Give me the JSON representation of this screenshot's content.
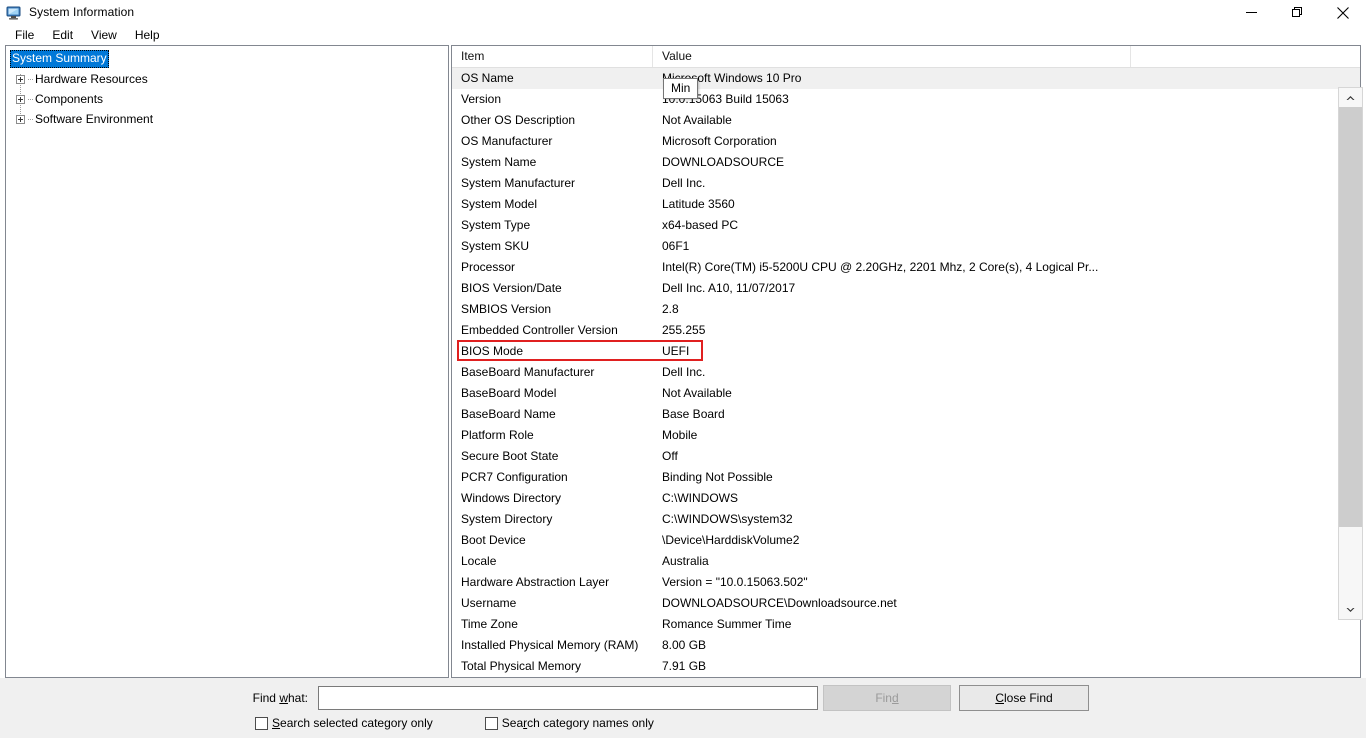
{
  "window": {
    "title": "System Information",
    "icon": "computer-icon",
    "controls": {
      "minimize": "minimize-icon",
      "restore": "restore-icon",
      "close": "close-icon"
    }
  },
  "menubar": {
    "items": [
      "File",
      "Edit",
      "View",
      "Help"
    ]
  },
  "tree": {
    "selected": "System Summary",
    "items": [
      {
        "label": "System Summary",
        "expandable": false,
        "selected": true
      },
      {
        "label": "Hardware Resources",
        "expandable": true,
        "selected": false
      },
      {
        "label": "Components",
        "expandable": true,
        "selected": false
      },
      {
        "label": "Software Environment",
        "expandable": true,
        "selected": false
      }
    ]
  },
  "tooltip": {
    "text": "Min"
  },
  "list": {
    "columns": [
      "Item",
      "Value"
    ],
    "rows": [
      {
        "item": "OS Name",
        "value": "Microsoft Windows 10 Pro"
      },
      {
        "item": "Version",
        "value": "10.0.15063 Build 15063"
      },
      {
        "item": "Other OS Description",
        "value": "Not Available"
      },
      {
        "item": "OS Manufacturer",
        "value": "Microsoft Corporation"
      },
      {
        "item": "System Name",
        "value": "DOWNLOADSOURCE"
      },
      {
        "item": "System Manufacturer",
        "value": "Dell Inc."
      },
      {
        "item": "System Model",
        "value": "Latitude 3560"
      },
      {
        "item": "System Type",
        "value": "x64-based PC"
      },
      {
        "item": "System SKU",
        "value": "06F1"
      },
      {
        "item": "Processor",
        "value": "Intel(R) Core(TM) i5-5200U CPU @ 2.20GHz, 2201 Mhz, 2 Core(s), 4 Logical Pr..."
      },
      {
        "item": "BIOS Version/Date",
        "value": "Dell Inc. A10, 11/07/2017"
      },
      {
        "item": "SMBIOS Version",
        "value": "2.8"
      },
      {
        "item": "Embedded Controller Version",
        "value": "255.255"
      },
      {
        "item": "BIOS Mode",
        "value": "UEFI",
        "highlighted": true
      },
      {
        "item": "BaseBoard Manufacturer",
        "value": "Dell Inc."
      },
      {
        "item": "BaseBoard Model",
        "value": "Not Available"
      },
      {
        "item": "BaseBoard Name",
        "value": "Base Board"
      },
      {
        "item": "Platform Role",
        "value": "Mobile"
      },
      {
        "item": "Secure Boot State",
        "value": "Off"
      },
      {
        "item": "PCR7 Configuration",
        "value": "Binding Not Possible"
      },
      {
        "item": "Windows Directory",
        "value": "C:\\WINDOWS"
      },
      {
        "item": "System Directory",
        "value": "C:\\WINDOWS\\system32"
      },
      {
        "item": "Boot Device",
        "value": "\\Device\\HarddiskVolume2"
      },
      {
        "item": "Locale",
        "value": "Australia"
      },
      {
        "item": "Hardware Abstraction Layer",
        "value": "Version = \"10.0.15063.502\""
      },
      {
        "item": "Username",
        "value": "DOWNLOADSOURCE\\Downloadsource.net"
      },
      {
        "item": "Time Zone",
        "value": "Romance Summer Time"
      },
      {
        "item": "Installed Physical Memory (RAM)",
        "value": "8.00 GB"
      },
      {
        "item": "Total Physical Memory",
        "value": "7.91 GB"
      }
    ]
  },
  "findbar": {
    "label_pre": "Find ",
    "label_accel": "w",
    "label_post": "hat:",
    "input_value": "",
    "input_placeholder": "",
    "find_button": {
      "pre": "Fin",
      "accel": "d",
      "post": "",
      "disabled": true
    },
    "close_button": {
      "pre": "",
      "accel": "C",
      "post": "lose Find",
      "disabled": false
    },
    "checkbox1": {
      "pre": "",
      "accel": "S",
      "post": "earch selected category only",
      "checked": false
    },
    "checkbox2": {
      "pre": "Sea",
      "accel": "r",
      "post": "ch category names only",
      "checked": false
    }
  },
  "scrollbar": {
    "up_arrow": "chevron-up-icon",
    "down_arrow": "chevron-down-icon"
  },
  "colors": {
    "selection": "#0078d7",
    "highlight_box": "#e02020",
    "chrome": "#f0f0f0"
  }
}
